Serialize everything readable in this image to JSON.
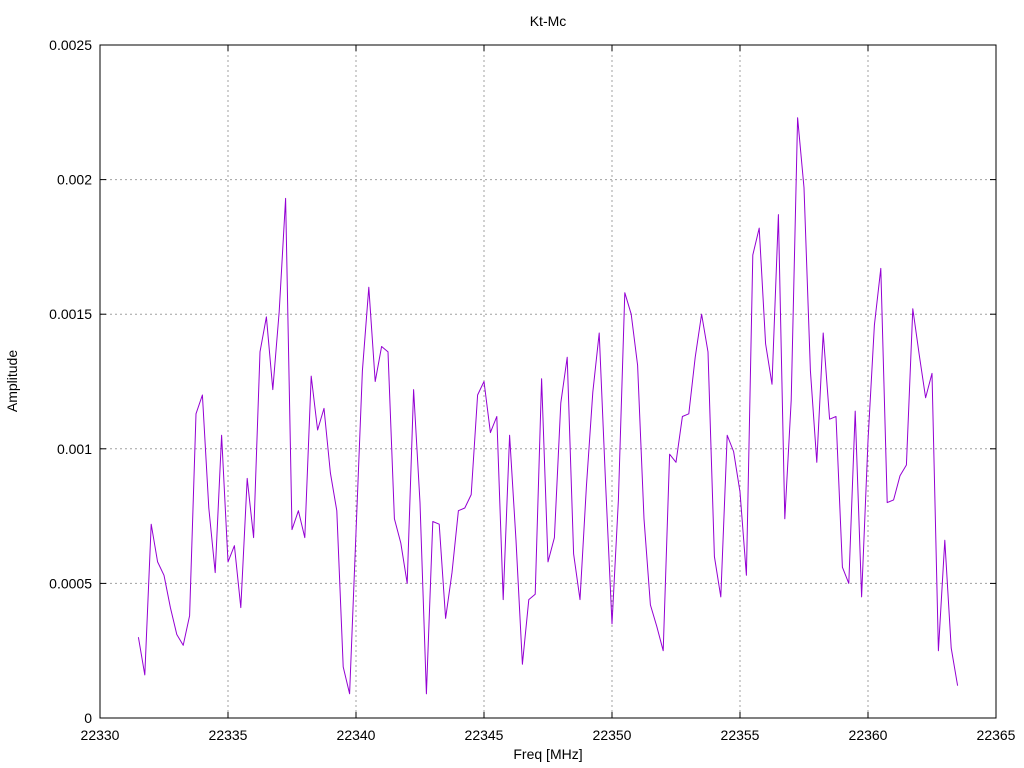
{
  "chart_data": {
    "type": "line",
    "title": "Kt-Mc",
    "xlabel": "Freq [MHz]",
    "ylabel": "Amplitude",
    "xlim": [
      22330,
      22365
    ],
    "ylim": [
      0,
      0.0025
    ],
    "xticks": [
      22330,
      22335,
      22340,
      22345,
      22350,
      22355,
      22360,
      22365
    ],
    "yticks": [
      0,
      0.0005,
      0.001,
      0.0015,
      0.002,
      0.0025
    ],
    "xtick_labels": [
      "22330",
      "22335",
      "22340",
      "22345",
      "22350",
      "22355",
      "22360",
      "22365"
    ],
    "ytick_labels": [
      "0",
      "0.0005",
      "0.001",
      "0.0015",
      "0.002",
      "0.0025"
    ],
    "grid": true,
    "series": [
      {
        "color": "#9400d3",
        "x": [
          22331.5,
          22331.75,
          22332.0,
          22332.25,
          22332.5,
          22332.75,
          22333.0,
          22333.25,
          22333.5,
          22333.75,
          22334.0,
          22334.25,
          22334.5,
          22334.75,
          22335.0,
          22335.25,
          22335.5,
          22335.75,
          22336.0,
          22336.25,
          22336.5,
          22336.75,
          22337.0,
          22337.25,
          22337.5,
          22337.75,
          22338.0,
          22338.25,
          22338.5,
          22338.75,
          22339.0,
          22339.25,
          22339.5,
          22339.75,
          22340.0,
          22340.25,
          22340.5,
          22340.75,
          22341.0,
          22341.25,
          22341.5,
          22341.75,
          22342.0,
          22342.25,
          22342.5,
          22342.75,
          22343.0,
          22343.25,
          22343.5,
          22343.75,
          22344.0,
          22344.25,
          22344.5,
          22344.75,
          22345.0,
          22345.25,
          22345.5,
          22345.75,
          22346.0,
          22346.25,
          22346.5,
          22346.75,
          22347.0,
          22347.25,
          22347.5,
          22347.75,
          22348.0,
          22348.25,
          22348.5,
          22348.75,
          22349.0,
          22349.25,
          22349.5,
          22349.75,
          22350.0,
          22350.25,
          22350.5,
          22350.75,
          22351.0,
          22351.25,
          22351.5,
          22351.75,
          22352.0,
          22352.25,
          22352.5,
          22352.75,
          22353.0,
          22353.25,
          22353.5,
          22353.75,
          22354.0,
          22354.25,
          22354.5,
          22354.75,
          22355.0,
          22355.25,
          22355.5,
          22355.75,
          22356.0,
          22356.25,
          22356.5,
          22356.75,
          22357.0,
          22357.25,
          22357.5,
          22357.75,
          22358.0,
          22358.25,
          22358.5,
          22358.75,
          22359.0,
          22359.25,
          22359.5,
          22359.75,
          22360.0,
          22360.25,
          22360.5,
          22360.75,
          22361.0,
          22361.25,
          22361.5,
          22361.75,
          22362.0,
          22362.25,
          22362.5,
          22362.75,
          22363.0,
          22363.25,
          22363.5
        ],
        "values": [
          0.0003,
          0.00016,
          0.00072,
          0.00058,
          0.00053,
          0.00041,
          0.00031,
          0.00027,
          0.00038,
          0.00113,
          0.0012,
          0.00078,
          0.00054,
          0.00105,
          0.00058,
          0.00064,
          0.00041,
          0.00089,
          0.00067,
          0.00136,
          0.00149,
          0.00122,
          0.00151,
          0.00193,
          0.0007,
          0.00077,
          0.00067,
          0.00127,
          0.00107,
          0.00115,
          0.00091,
          0.00077,
          0.00019,
          9e-05,
          0.00069,
          0.00129,
          0.0016,
          0.00125,
          0.00138,
          0.00136,
          0.00074,
          0.00065,
          0.0005,
          0.00122,
          0.0008,
          9e-05,
          0.00073,
          0.00072,
          0.00037,
          0.00054,
          0.00077,
          0.00078,
          0.00083,
          0.0012,
          0.00125,
          0.00106,
          0.00112,
          0.00044,
          0.00105,
          0.00066,
          0.0002,
          0.00044,
          0.00046,
          0.00126,
          0.00058,
          0.00067,
          0.00117,
          0.00134,
          0.00061,
          0.00044,
          0.00086,
          0.00121,
          0.00143,
          0.00087,
          0.00035,
          0.00081,
          0.00158,
          0.0015,
          0.00131,
          0.00074,
          0.00042,
          0.00034,
          0.00025,
          0.00098,
          0.00095,
          0.00112,
          0.00113,
          0.00134,
          0.0015,
          0.00136,
          0.0006,
          0.00045,
          0.00105,
          0.00099,
          0.00084,
          0.00053,
          0.00172,
          0.00182,
          0.00139,
          0.00124,
          0.00187,
          0.00074,
          0.00118,
          0.00223,
          0.00197,
          0.00129,
          0.00095,
          0.00143,
          0.00111,
          0.00112,
          0.00056,
          0.0005,
          0.00114,
          0.00045,
          0.00103,
          0.00146,
          0.00167,
          0.0008,
          0.00081,
          0.0009,
          0.00094,
          0.00152,
          0.00135,
          0.00119,
          0.00128,
          0.00025,
          0.00066,
          0.00026,
          0.00012
        ]
      }
    ]
  }
}
